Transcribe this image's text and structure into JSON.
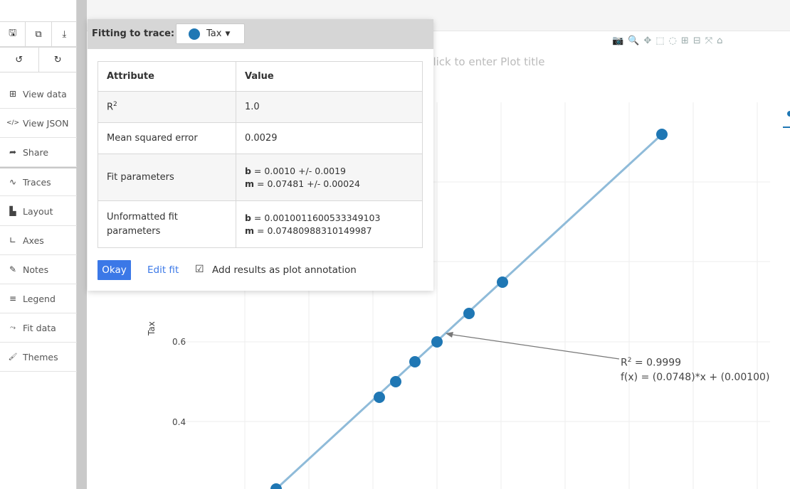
{
  "sidebar": {
    "toolbar_rows": [
      [
        {
          "icon": "save-icon",
          "glyph": "🖫"
        },
        {
          "icon": "copy-icon",
          "glyph": "⧉"
        },
        {
          "icon": "download-icon",
          "glyph": "⤓"
        }
      ],
      [
        {
          "icon": "undo-icon",
          "glyph": "↺"
        },
        {
          "icon": "redo-icon",
          "glyph": "↻"
        }
      ]
    ],
    "items": [
      {
        "id": "view-data",
        "label": "View data",
        "icon": "grid-icon",
        "glyph": "⊞"
      },
      {
        "id": "view-json",
        "label": "View JSON",
        "icon": "code-icon",
        "glyph": "</>"
      },
      {
        "id": "share",
        "label": "Share",
        "icon": "share-icon",
        "glyph": "➦"
      },
      {
        "id": "traces",
        "label": "Traces",
        "icon": "traces-icon",
        "glyph": "∿"
      },
      {
        "id": "layout",
        "label": "Layout",
        "icon": "layout-icon",
        "glyph": "▙"
      },
      {
        "id": "axes",
        "label": "Axes",
        "icon": "axes-icon",
        "glyph": "∟"
      },
      {
        "id": "notes",
        "label": "Notes",
        "icon": "pencil-icon",
        "glyph": "✎"
      },
      {
        "id": "legend",
        "label": "Legend",
        "icon": "legend-icon",
        "glyph": "≡"
      },
      {
        "id": "fit-data",
        "label": "Fit data",
        "icon": "fit-icon",
        "glyph": "⤳"
      },
      {
        "id": "themes",
        "label": "Themes",
        "icon": "paint-roller-icon",
        "glyph": "🖌"
      }
    ]
  },
  "dialog": {
    "title": "Fitting to trace:",
    "trace_name": "Tax",
    "trace_color": "#1f77b4",
    "table": {
      "headers": [
        "Attribute",
        "Value"
      ],
      "rows": {
        "r2": {
          "label_base": "R",
          "label_sup": "2",
          "value": "1.0"
        },
        "mse": {
          "label": "Mean squared error",
          "value": "0.0029"
        },
        "fit": {
          "label": "Fit parameters",
          "b_key": "b",
          "b_val": " = 0.0010 +/- 0.0019",
          "m_key": "m",
          "m_val": " = 0.07481 +/- 0.00024"
        },
        "unformatted": {
          "label": "Unformatted fit parameters",
          "b_key": "b",
          "b_val": " = 0.0010011600533349103",
          "m_key": "m",
          "m_val": " = 0.07480988310149987"
        }
      }
    },
    "okay_label": "Okay",
    "edit_fit_label": "Edit fit",
    "checkbox_glyph": "☑",
    "annotation_label": "Add results as plot annotation"
  },
  "plot": {
    "title_placeholder": "Click to enter Plot title",
    "ylabel": "Tax",
    "yticks": {
      "t06": "0.6",
      "t04": "0.4"
    },
    "annotation": {
      "r2_base": "R",
      "r2_sup": "2",
      "r2_val": " = 0.9999",
      "fx": "f(x) = (0.0748)*x + (0.00100)"
    },
    "modebar": [
      "camera-icon",
      "zoom-icon",
      "pan-icon",
      "box-select-icon",
      "lasso-icon",
      "zoom-in-icon",
      "zoom-out-icon",
      "autoscale-icon",
      "home-icon"
    ],
    "colors": {
      "marker": "#1f77b4",
      "fit_line": "#8fbbd9",
      "arrow": "#777777"
    }
  }
}
